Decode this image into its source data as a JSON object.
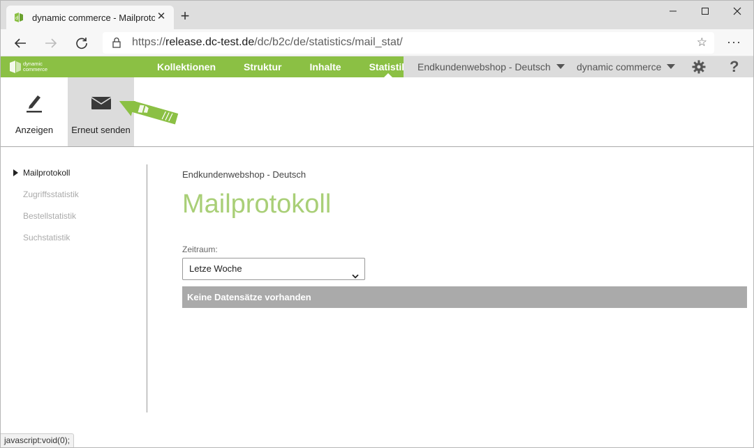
{
  "browser": {
    "tab_title": "dynamic commerce - Mailprotokoll",
    "url_prefix": "https://",
    "url_host": "release.dc-test.de",
    "url_path": "/dc/b2c/de/statistics/mail_stat/",
    "status_text": "javascript:void(0);"
  },
  "app": {
    "logo_line1": "dynamic",
    "logo_line2": "commerce",
    "brand_color": "#8bc044",
    "nav": [
      {
        "label": "Kollektionen",
        "active": false
      },
      {
        "label": "Struktur",
        "active": false
      },
      {
        "label": "Inhalte",
        "active": false
      },
      {
        "label": "Statistik",
        "active": true
      }
    ],
    "shop_select": "Endkundenwebshop - Deutsch",
    "company_select": "dynamic commerce",
    "help_label": "?"
  },
  "toolbar": {
    "show_label": "Anzeigen",
    "resend_label": "Erneut senden"
  },
  "sidebar": {
    "items": [
      {
        "label": "Mailprotokoll",
        "active": true
      },
      {
        "label": "Zugriffsstatistik",
        "active": false
      },
      {
        "label": "Bestellstatistik",
        "active": false
      },
      {
        "label": "Suchstatistik",
        "active": false
      }
    ]
  },
  "main": {
    "shop_name": "Endkundenwebshop - Deutsch",
    "title": "Mailprotokoll",
    "period_label": "Zeitraum:",
    "period_value": "Letze Woche",
    "empty_message": "Keine Datensätze vorhanden"
  }
}
